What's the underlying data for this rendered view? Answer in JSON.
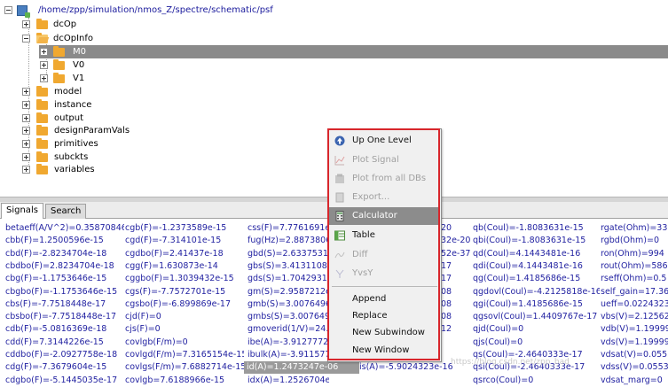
{
  "tree": {
    "root_path": "/home/zpp/simulation/nmos_Z/spectre/schematic/psf",
    "items": [
      {
        "label": "dcOp",
        "expanded": false
      },
      {
        "label": "dcOpInfo",
        "expanded": true
      },
      {
        "label": "M0",
        "expanded": false,
        "selected": true
      },
      {
        "label": "V0",
        "expanded": false
      },
      {
        "label": "V1",
        "expanded": false
      },
      {
        "label": "model",
        "expanded": false
      },
      {
        "label": "instance",
        "expanded": false
      },
      {
        "label": "output",
        "expanded": false
      },
      {
        "label": "designParamVals",
        "expanded": false
      },
      {
        "label": "primitives",
        "expanded": false
      },
      {
        "label": "subckts",
        "expanded": false
      },
      {
        "label": "variables",
        "expanded": false
      }
    ]
  },
  "tabs": [
    {
      "label": "Signals",
      "active": true
    },
    {
      "label": "Search",
      "active": false
    }
  ],
  "signals": {
    "columns": [
      [
        "betaeff(A/V^2)=0.35870846",
        "cbb(F)=1.2500596e-15",
        "cbd(F)=-2.8234704e-18",
        "cbdbo(F)=2.8234704e-18",
        "cbg(F)=-1.1753646e-15",
        "cbgbo(F)=-1.1753646e-15",
        "cbs(F)=-7.7518448e-17",
        "cbsbo(F)=-7.7518448e-17",
        "cdb(F)=-5.0816369e-18",
        "cdd(F)=7.3144226e-15",
        "cddbo(F)=-2.0927758e-18",
        "cdg(F)=-7.3679604e-15",
        "cdgbo(F)=-5.1445035e-17"
      ],
      [
        "cgb(F)=-1.2373589e-15",
        "cgd(F)=-7.314101e-15",
        "cgdbo(F)=2.41437e-18",
        "cgg(F)=1.630873e-14",
        "cggbo(F)=1.3039432e-15",
        "cgs(F)=-7.7572701e-15",
        "cgsbo(F)=-6.899869e-17",
        "cjd(F)=0",
        "cjs(F)=0",
        "covlgb(F/m)=0",
        "covlgd(F/m)=7.3165154e-15",
        "covlgs(F/m)=7.6882714e-15",
        "covlgb=7.6188966e-15"
      ],
      [
        "css(F)=7.7761691e-",
        "fug(Hz)=2.8873806e",
        "gbd(S)=2.6337531e",
        "gbs(S)=3.4131108e-",
        "gds(S)=1.7042931e-",
        "gm(S)=2.9587212e-",
        "gmb(S)=3.0076496",
        "gmbs(S)=3.0076496",
        "gmoverid(1/V)=24.5",
        "ibe(A)=-3.9127772e",
        "ibulk(A)=-3.9115772",
        "id(A)=1.2473247e-06",
        "idx(A)=1.2526704e-"
      ],
      [
        "20",
        "32e-20",
        "52e-37",
        "17",
        "17",
        "08",
        "08",
        "08",
        "12",
        "",
        "",
        "",
        ""
      ],
      [
        "qb(Coul)=-1.8083631e-15",
        "qbi(Coul)=-1.8083631e-15",
        "qd(Coul)=4.1443481e-16",
        "qdi(Coul)=4.1443481e-16",
        "qg(Coul)=1.4185686e-15",
        "qgdovl(Coul)=-4.2125818e-16",
        "qgi(Coul)=1.4185686e-15",
        "qgsovl(Coul)=1.4409767e-17",
        "qjd(Coul)=0",
        "qjs(Coul)=0",
        "qs(Coul)=-2.4640333e-17",
        "qsi(Coul)=-2.4640333e-17",
        "qsrco(Coul)=0"
      ],
      [
        "rgate(Ohm)=33",
        "rgbd(Ohm)=0",
        "ron(Ohm)=994",
        "rout(Ohm)=586",
        "rseff(Ohm)=0.5",
        "self_gain=17.36",
        "ueff=0.0224323",
        "vbs(V)=2.12562",
        "vdb(V)=1.19999",
        "vds(V)=1.19999",
        "vdsat(V)=0.0553",
        "vdss(V)=0.0553",
        "vdsat_marg=0"
      ]
    ],
    "overlap_col": [
      "",
      "",
      "",
      "",
      "",
      "",
      "",
      "",
      "",
      "",
      "",
      "is(A)=-5.9024323e-16",
      ""
    ],
    "highlighted": "id(A)=1.2473247e-06"
  },
  "context_menu": {
    "items": [
      {
        "label": "Up One Level",
        "icon": "up-arrow-icon",
        "enabled": true
      },
      {
        "label": "Plot Signal",
        "icon": "plot-signal-icon",
        "enabled": false
      },
      {
        "label": "Plot from all DBs",
        "icon": "plot-all-icon",
        "enabled": false
      },
      {
        "label": "Export...",
        "icon": "export-icon",
        "enabled": false
      },
      {
        "label": "Calculator",
        "icon": "calculator-icon",
        "enabled": true,
        "hover": true
      },
      {
        "label": "Table",
        "icon": "table-icon",
        "enabled": true
      },
      {
        "label": "Diff",
        "icon": "diff-icon",
        "enabled": false
      },
      {
        "label": "YvsY",
        "icon": "yvsy-icon",
        "enabled": false
      },
      {
        "label": "Append",
        "enabled": true
      },
      {
        "label": "Replace",
        "enabled": true
      },
      {
        "label": "New Subwindow",
        "enabled": true
      },
      {
        "label": "New Window",
        "enabled": true
      }
    ]
  },
  "watermark": "https://blog.csdn.net/zpp_bad",
  "colors": {
    "signal_text": "#1f1fa0",
    "callout_border": "#d8262c",
    "selection": "#8a8a8a",
    "folder": "#f0a830"
  }
}
